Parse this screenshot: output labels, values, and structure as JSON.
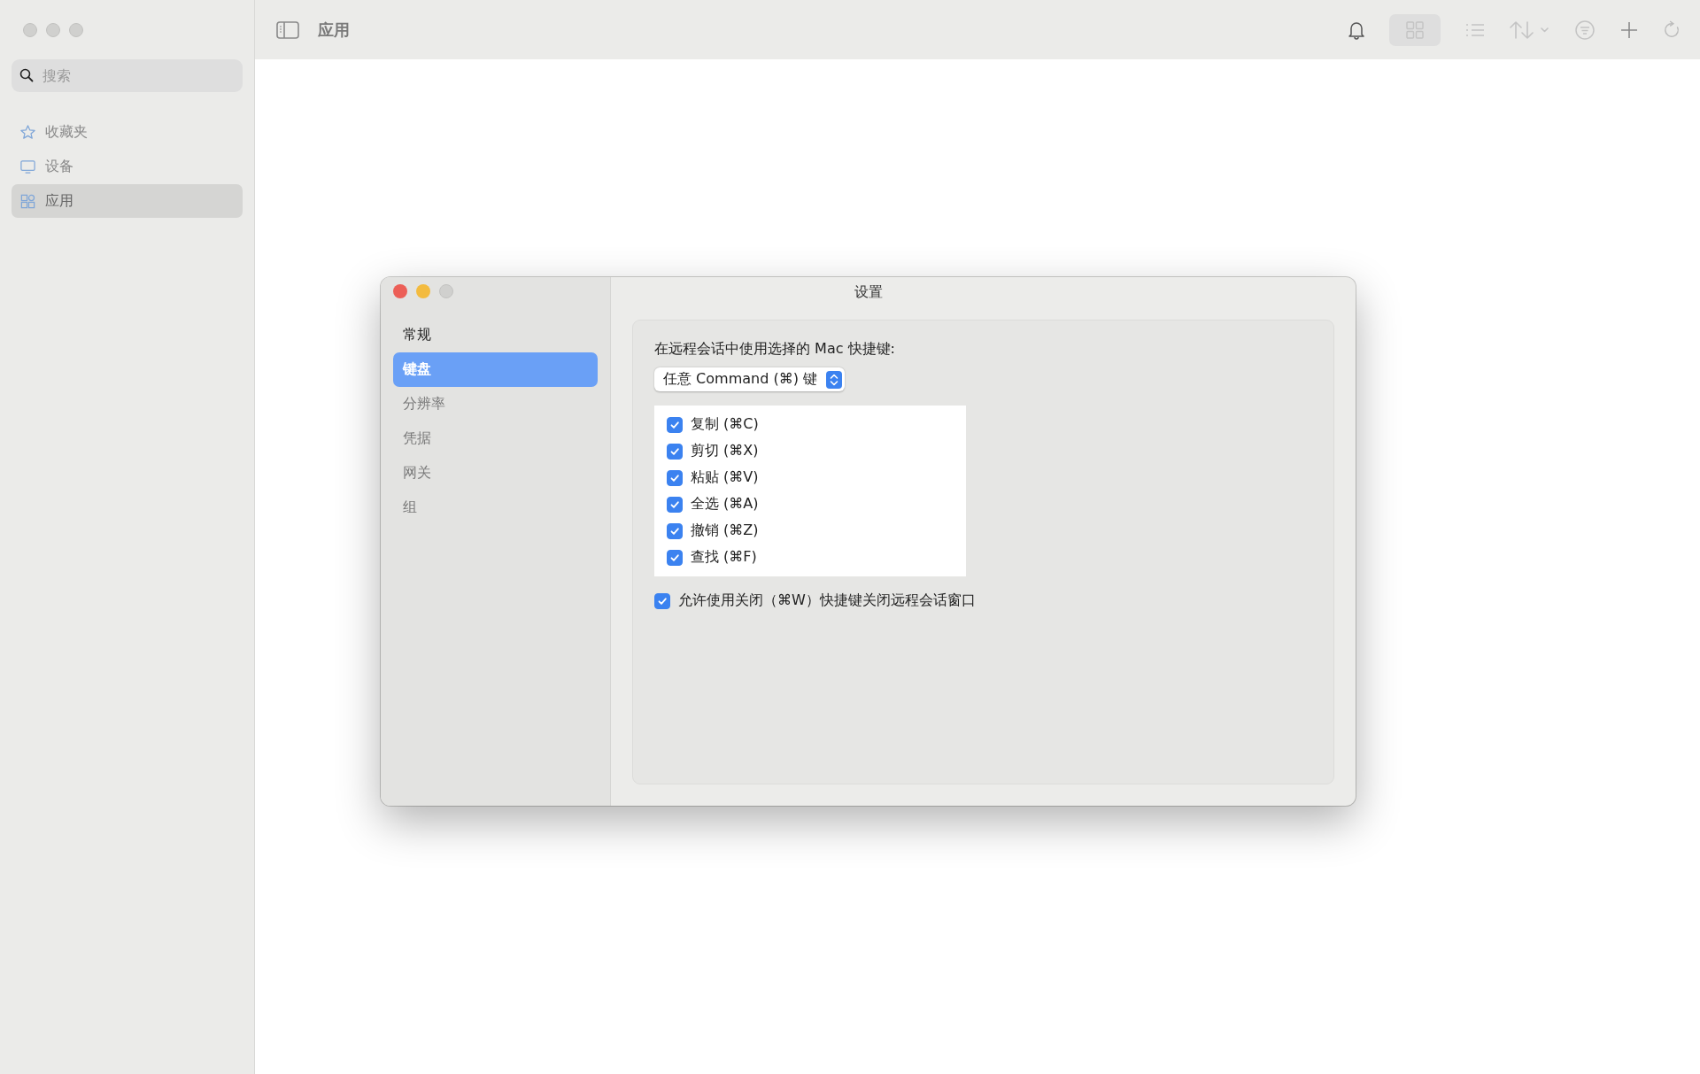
{
  "sidebar": {
    "search": {
      "placeholder": "搜索"
    },
    "items": [
      {
        "label": "收藏夹",
        "selected": false
      },
      {
        "label": "设备",
        "selected": false
      },
      {
        "label": "应用",
        "selected": true
      }
    ]
  },
  "toolbar": {
    "title": "应用",
    "view_grid_selected": true
  },
  "settings": {
    "title": "设置",
    "nav": [
      {
        "label": "常规",
        "selected": false,
        "disabled": false
      },
      {
        "label": "键盘",
        "selected": true,
        "disabled": false
      },
      {
        "label": "分辨率",
        "selected": false,
        "disabled": true
      },
      {
        "label": "凭据",
        "selected": false,
        "disabled": true
      },
      {
        "label": "网关",
        "selected": false,
        "disabled": true
      },
      {
        "label": "组",
        "selected": false,
        "disabled": true
      }
    ],
    "shortcut_label": "在远程会话中使用选择的 Mac 快捷键:",
    "shortcut_popup": "任意 Command (⌘) 键",
    "shortcuts": [
      {
        "label": "复制 (⌘C)",
        "checked": true
      },
      {
        "label": "剪切 (⌘X)",
        "checked": true
      },
      {
        "label": "粘贴 (⌘V)",
        "checked": true
      },
      {
        "label": "全选 (⌘A)",
        "checked": true
      },
      {
        "label": "撤销 (⌘Z)",
        "checked": true
      },
      {
        "label": "查找 (⌘F)",
        "checked": true
      }
    ],
    "close_window": {
      "label": "允许使用关闭（⌘W）快捷键关闭远程会话窗口",
      "checked": true
    }
  }
}
